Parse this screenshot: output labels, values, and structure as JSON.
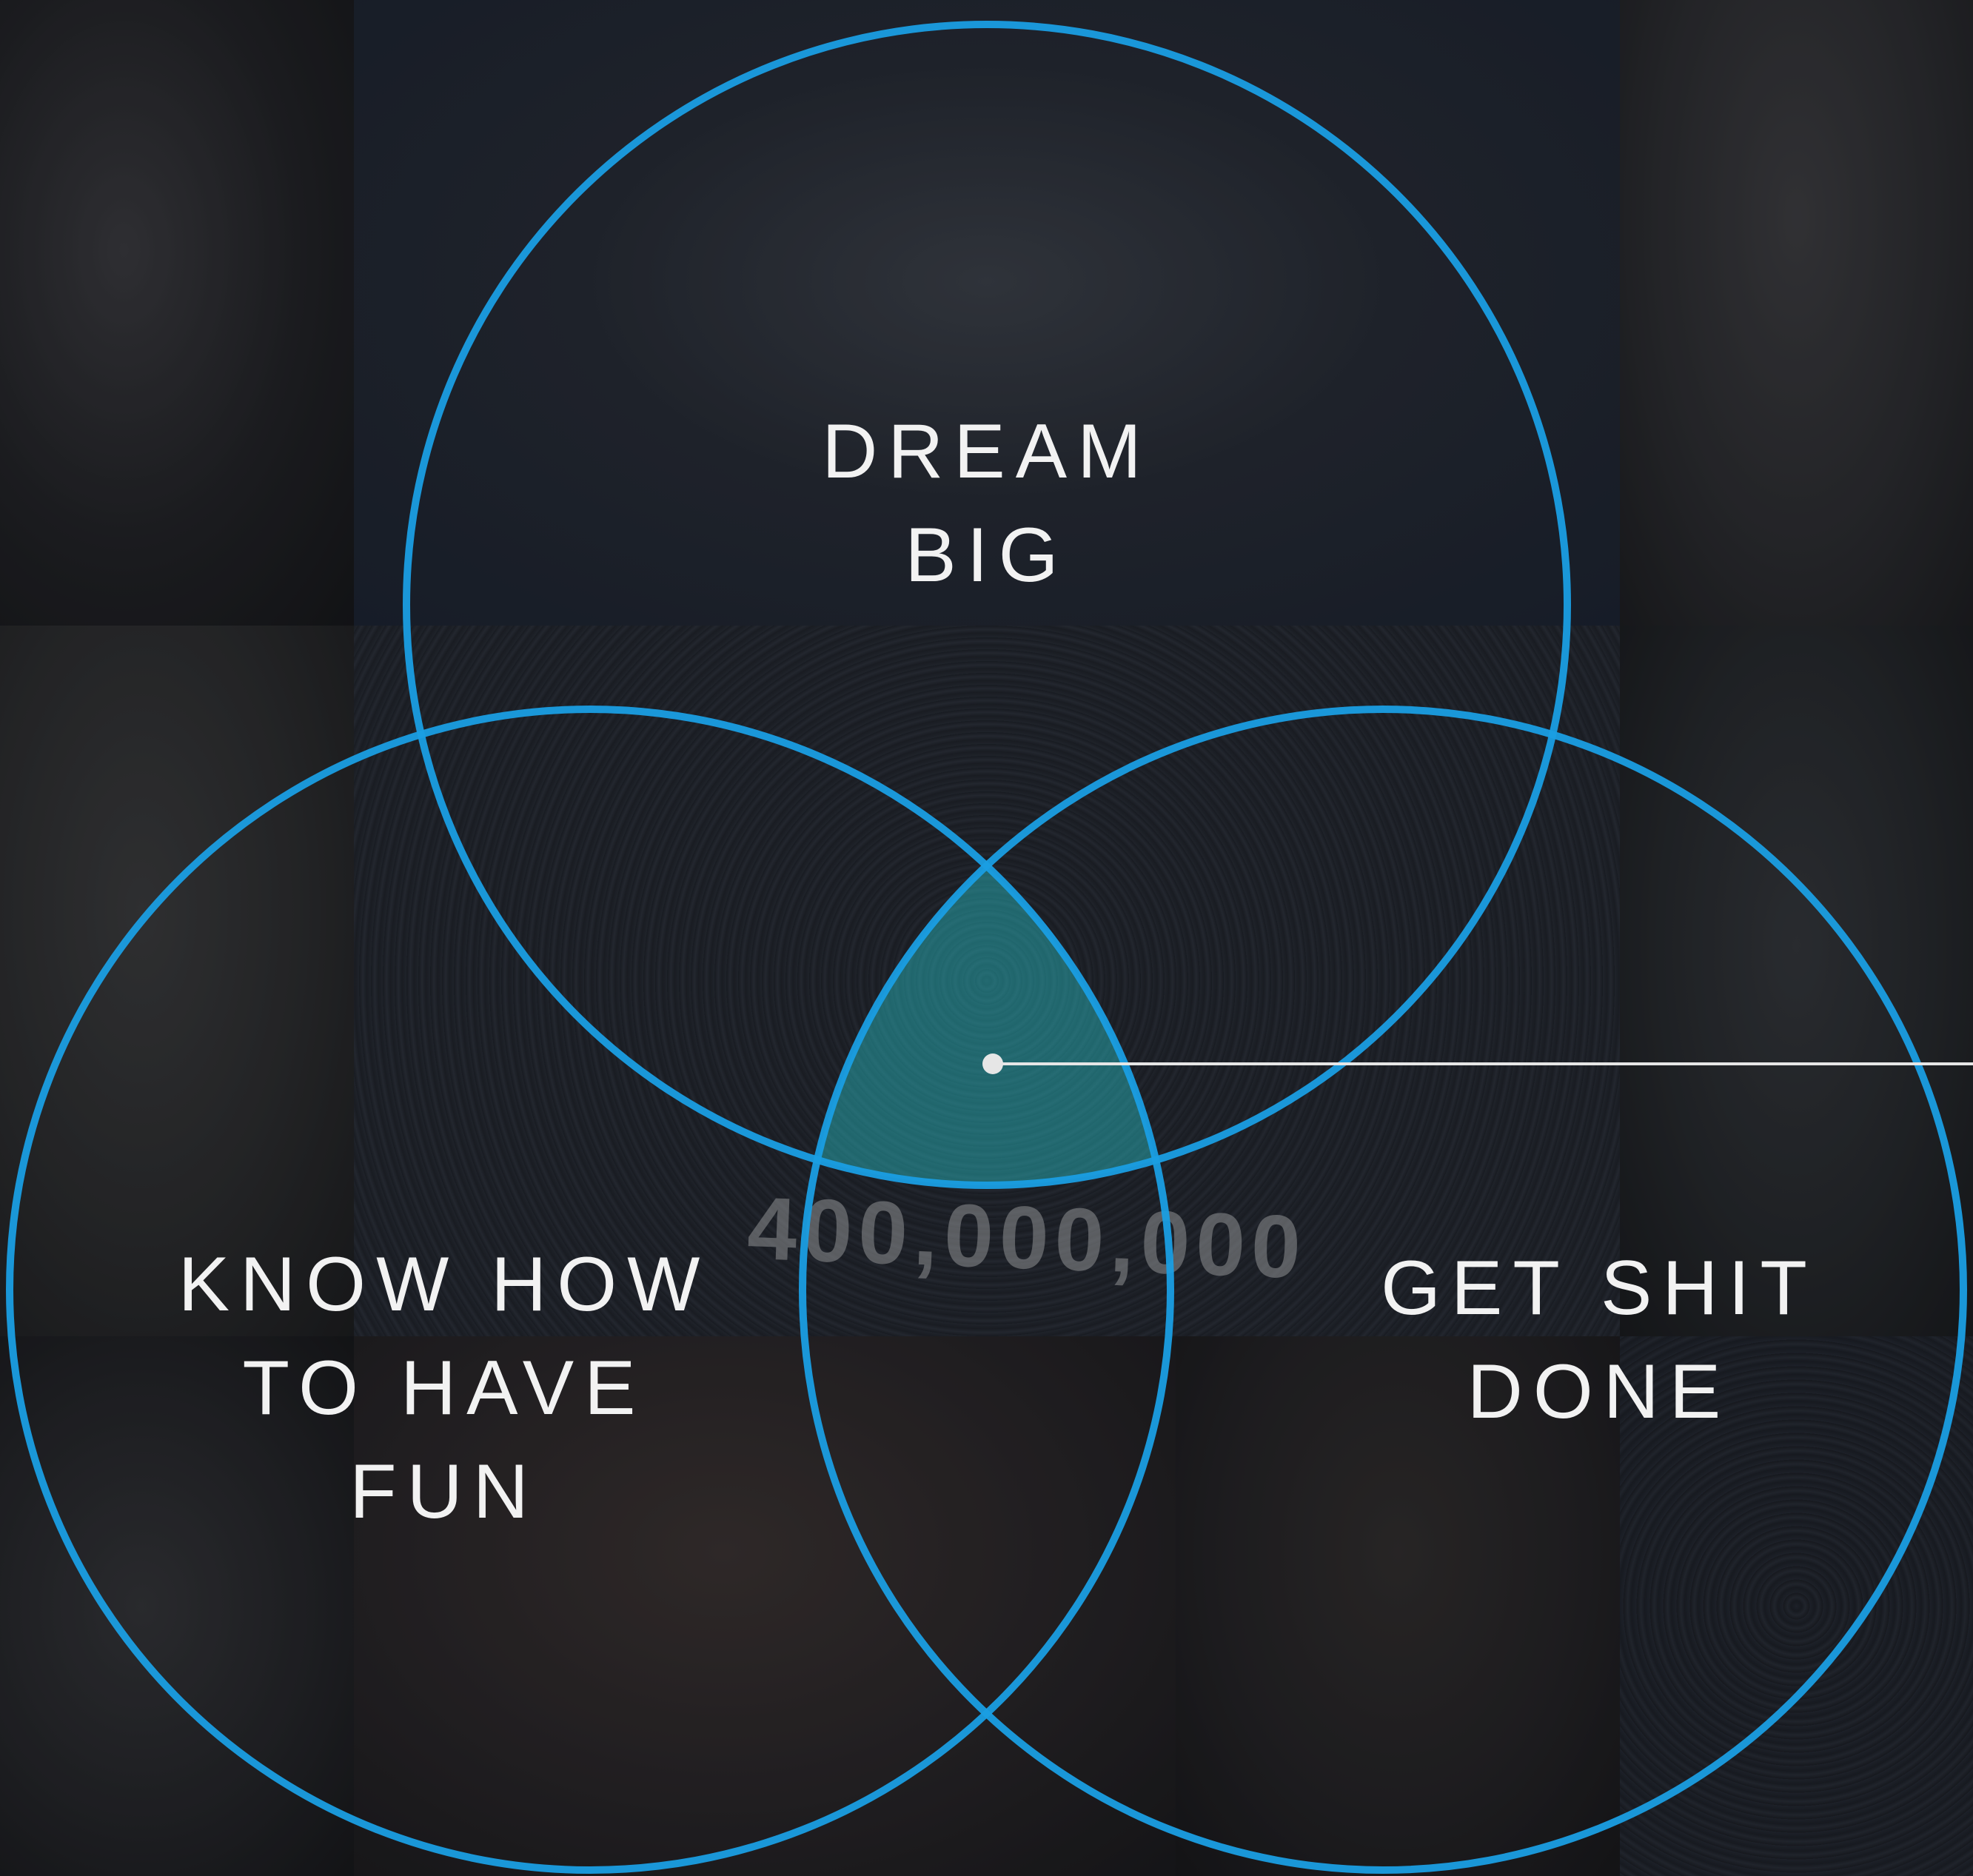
{
  "diagram": {
    "type": "venn",
    "circles": [
      {
        "id": "dream",
        "label": "DREAM\nBIG"
      },
      {
        "id": "fun",
        "label": "KNOW HOW\nTO HAVE\nFUN"
      },
      {
        "id": "done",
        "label": "GET SHIT\nDONE"
      }
    ],
    "colors": {
      "circle_stroke": "#1a9ee3",
      "intersection_fill": "#2bc0c8",
      "label_text": "#f2f2f2",
      "pointer": "#e6e6e6"
    }
  },
  "background": {
    "banner_text": "400,000,000"
  }
}
